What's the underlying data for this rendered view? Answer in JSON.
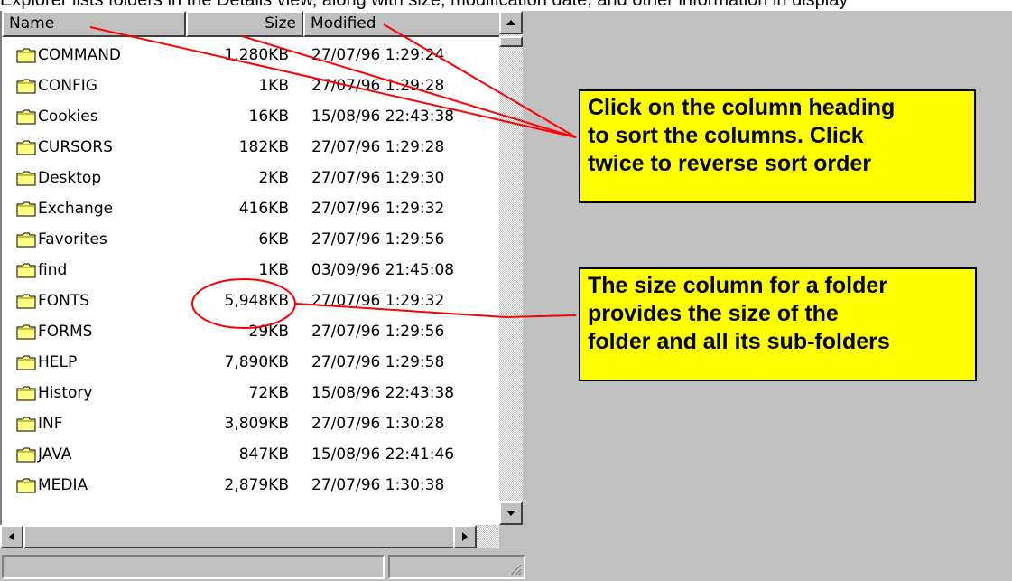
{
  "top_caption": "Explorer lists folders in the Details view, along with size, modification date, and other information in display",
  "columns": {
    "name": "Name",
    "size": "Size",
    "modified": "Modified"
  },
  "files": [
    {
      "name": "COMMAND",
      "size": "1,280KB",
      "modified": "27/07/96 1:29:24"
    },
    {
      "name": "CONFIG",
      "size": "1KB",
      "modified": "27/07/96 1:29:28"
    },
    {
      "name": "Cookies",
      "size": "16KB",
      "modified": "15/08/96 22:43:38"
    },
    {
      "name": "CURSORS",
      "size": "182KB",
      "modified": "27/07/96 1:29:28"
    },
    {
      "name": "Desktop",
      "size": "2KB",
      "modified": "27/07/96 1:29:30"
    },
    {
      "name": "Exchange",
      "size": "416KB",
      "modified": "27/07/96 1:29:32"
    },
    {
      "name": "Favorites",
      "size": "6KB",
      "modified": "27/07/96 1:29:56"
    },
    {
      "name": "find",
      "size": "1KB",
      "modified": "03/09/96 21:45:08"
    },
    {
      "name": "FONTS",
      "size": "5,948KB",
      "modified": "27/07/96 1:29:32"
    },
    {
      "name": "FORMS",
      "size": "29KB",
      "modified": "27/07/96 1:29:56"
    },
    {
      "name": "HELP",
      "size": "7,890KB",
      "modified": "27/07/96 1:29:58"
    },
    {
      "name": "History",
      "size": "72KB",
      "modified": "15/08/96 22:43:38"
    },
    {
      "name": "INF",
      "size": "3,809KB",
      "modified": "27/07/96 1:30:28"
    },
    {
      "name": "JAVA",
      "size": "847KB",
      "modified": "15/08/96 22:41:46"
    },
    {
      "name": "MEDIA",
      "size": "2,879KB",
      "modified": "27/07/96 1:30:38"
    }
  ],
  "callouts": {
    "sort": [
      "Click on the column heading",
      "to sort the columns. Click",
      "twice to reverse sort order"
    ],
    "size": [
      "The size column for a folder",
      "provides the size of the",
      "folder and all its sub-folders"
    ]
  },
  "icons": {
    "folder": "folder-icon",
    "scroll_up": "arrow-up-icon",
    "scroll_down": "arrow-down-icon",
    "scroll_left": "arrow-left-icon",
    "scroll_right": "arrow-right-icon",
    "grip": "resize-grip-icon"
  },
  "colors": {
    "callout_bg": "#ffff00",
    "annotation_line": "#ff0000",
    "folder": "#ffff80",
    "window_face": "#c0c0c0"
  }
}
